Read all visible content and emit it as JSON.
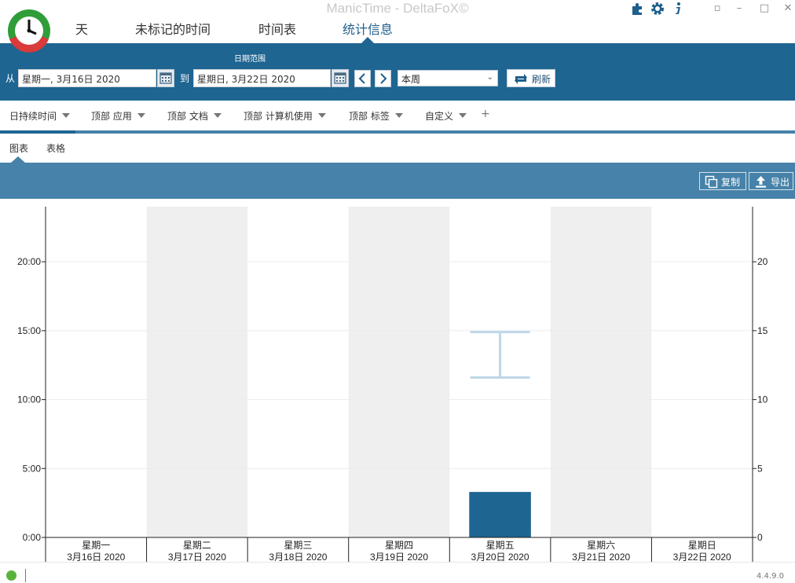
{
  "app": {
    "title": "ManicTime - DeltaFoX©",
    "colors": {
      "primary": "#1e6592",
      "toolbar": "#4682a9",
      "bar": "#1e6592",
      "band": "#efefef",
      "error_bar": "#bed7e8",
      "status_ok": "#58b33a"
    }
  },
  "titlebar": {
    "icons": [
      "puzzle-icon",
      "gear-icon",
      "info-icon"
    ],
    "window_buttons": [
      "restore-icon",
      "minimize-icon",
      "maximize-icon",
      "close-icon"
    ]
  },
  "nav": {
    "tabs": [
      {
        "label": "天",
        "active": false
      },
      {
        "label": "未标记的时间",
        "active": false
      },
      {
        "label": "时间表",
        "active": false
      },
      {
        "label": "统计信息",
        "active": true
      }
    ]
  },
  "date_range": {
    "label": "日期范围",
    "from_label": "从",
    "from_value": "星期一, 3月16日 2020",
    "to_label": "到",
    "to_value": "星期日, 3月22日 2020",
    "period": "本周",
    "refresh_label": "刷新"
  },
  "stats_tabs": {
    "tabs": [
      {
        "label": "日持续时间",
        "active": true
      },
      {
        "label": "顶部 应用",
        "active": false
      },
      {
        "label": "顶部 文档",
        "active": false
      },
      {
        "label": "顶部 计算机使用",
        "active": false
      },
      {
        "label": "顶部 标签",
        "active": false
      },
      {
        "label": "自定义",
        "active": false
      }
    ],
    "add_label": "+"
  },
  "view_tabs": {
    "tabs": [
      {
        "label": "图表",
        "active": true
      },
      {
        "label": "表格",
        "active": false
      }
    ]
  },
  "toolbar": {
    "copy_label": "复制",
    "export_label": "导出"
  },
  "chart_data": {
    "type": "bar",
    "categories": [
      [
        "星期一",
        "3月16日 2020"
      ],
      [
        "星期二",
        "3月17日 2020"
      ],
      [
        "星期三",
        "3月18日 2020"
      ],
      [
        "星期四",
        "3月19日 2020"
      ],
      [
        "星期五",
        "3月20日 2020"
      ],
      [
        "星期六",
        "3月21日 2020"
      ],
      [
        "星期日",
        "3月22日 2020"
      ]
    ],
    "values_hours": [
      0,
      0,
      0,
      0,
      3.3,
      0,
      0
    ],
    "range_marker": {
      "category_index": 4,
      "low": 11.6,
      "high": 14.9
    },
    "weekend_or_alternate_bands": [
      1,
      3,
      5
    ],
    "ylim": [
      0,
      24
    ],
    "left_ticks": [
      "0:00",
      "5:00",
      "10:00",
      "15:00",
      "20:00"
    ],
    "left_tick_values": [
      0,
      5,
      10,
      15,
      20
    ],
    "right_ticks": [
      "0",
      "5",
      "10",
      "15",
      "20"
    ],
    "right_tick_values": [
      0,
      5,
      10,
      15,
      20
    ],
    "grid": true
  },
  "status": {
    "version": "4.4.9.0"
  }
}
